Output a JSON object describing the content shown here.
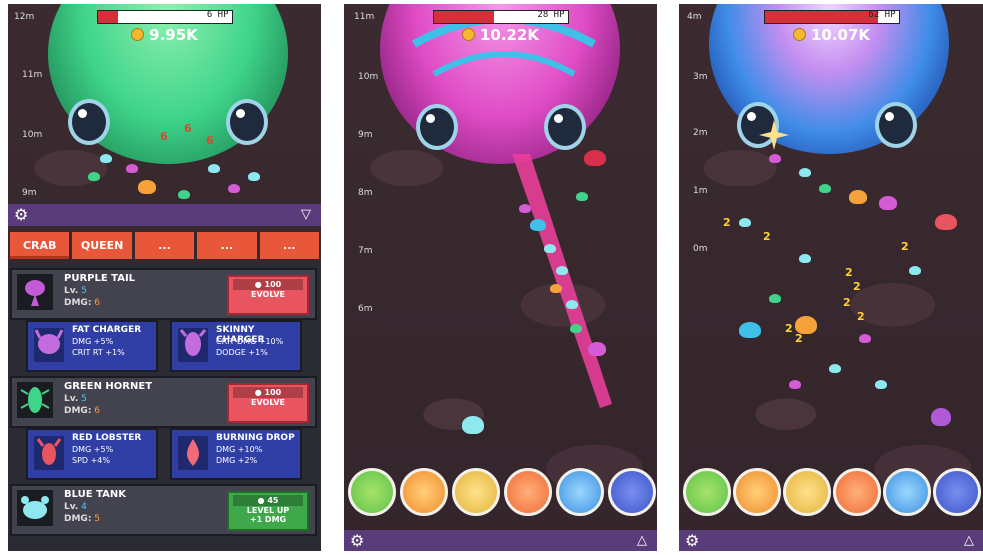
{
  "screens": [
    {
      "hp_text": "6 HP",
      "hp_fill": 0.15,
      "coins": "9.95K",
      "depth_labels": [
        "12m",
        "11m",
        "10m",
        "9m"
      ],
      "tabs": [
        "CRAB",
        "QUEEN",
        "...",
        "...",
        "..."
      ],
      "units": [
        {
          "name": "PURPLE TAIL",
          "lv_label": "Lv.",
          "lv": "5",
          "dmg_label": "DMG:",
          "dmg": "6",
          "cost": "100",
          "action": "EVOLVE",
          "evolutions": [
            {
              "name": "FAT CHARGER",
              "stat1": "DMG +5%",
              "stat2": "CRIT RT +1%"
            },
            {
              "name": "SKINNY CHARGER",
              "stat1": "CRIT DMG +10%",
              "stat2": "DODGE +1%"
            }
          ]
        },
        {
          "name": "GREEN HORNET",
          "lv_label": "Lv.",
          "lv": "5",
          "dmg_label": "DMG:",
          "dmg": "6",
          "cost": "100",
          "action": "EVOLVE",
          "evolutions": [
            {
              "name": "RED LOBSTER",
              "stat1": "DMG +5%",
              "stat2": "SPD +4%"
            },
            {
              "name": "BURNING DROP",
              "stat1": "DMG +10%",
              "stat2": "DMG +2%"
            }
          ]
        },
        {
          "name": "BLUE TANK",
          "lv_label": "Lv.",
          "lv": "4",
          "dmg_label": "DMG:",
          "dmg": "5",
          "cost": "45",
          "action_line1": "LEVEL UP",
          "action_line2": "+1 DMG"
        }
      ],
      "damage_numbers": [
        "6",
        "6",
        "6"
      ],
      "colors": {
        "boss": "#3fd48a",
        "menu": "#5b3c7a",
        "tab": "#e9573a"
      }
    },
    {
      "hp_text": "28 HP",
      "hp_fill": 0.45,
      "coins": "10.22K",
      "depth_labels": [
        "11m",
        "10m",
        "9m",
        "8m",
        "7m",
        "6m"
      ],
      "colors": {
        "boss": "#e04cc6"
      }
    },
    {
      "hp_text": "62 HP",
      "hp_fill": 0.85,
      "coins": "10.07K",
      "depth_labels": [
        "4m",
        "3m",
        "2m",
        "1m",
        "0m"
      ],
      "damage_numbers": [
        "2",
        "2",
        "2",
        "2",
        "2",
        "2",
        "2",
        "2",
        "2"
      ],
      "colors": {
        "boss": "#3f8de8"
      }
    }
  ],
  "icons": [
    "gear-icon",
    "triangle-down-icon",
    "triangle-up-icon"
  ],
  "skill_orbs": [
    {
      "name": "green-shell-orb",
      "color": "#5fc24a"
    },
    {
      "name": "orange-burst-orb",
      "color": "#f08b2c"
    },
    {
      "name": "gold-tank-orb",
      "color": "#e3b33c"
    },
    {
      "name": "orange-flame-orb",
      "color": "#f06a36"
    },
    {
      "name": "blue-crab-orb",
      "color": "#3e8fe0"
    },
    {
      "name": "red-crab-orb",
      "color": "#3a56c8"
    }
  ]
}
